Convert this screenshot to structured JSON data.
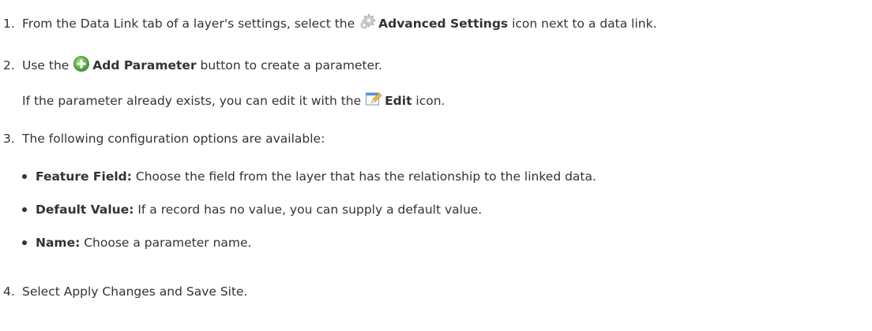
{
  "steps": [
    {
      "number": "1.",
      "pre": "From the Data Link tab of a layer's settings, select the",
      "icon": "gear-icon",
      "bold": "Advanced Settings",
      "post": "icon next to a data link."
    },
    {
      "number": "2.",
      "pre": "Use the",
      "icon": "add-plus-icon",
      "bold": "Add Parameter",
      "post": "button to create a parameter.",
      "note": {
        "pre": "If the parameter already exists, you can edit it with the",
        "icon": "edit-pencil-icon",
        "bold": "Edit",
        "post": "icon."
      }
    },
    {
      "number": "3.",
      "text": "The following configuration options are available:",
      "options": [
        {
          "label": "Feature Field:",
          "text": "Choose the field from the layer that has the relationship to the linked data."
        },
        {
          "label": "Default Value:",
          "text": "If a record has no value, you can supply a default value."
        },
        {
          "label": "Name:",
          "text": "Choose a parameter name."
        }
      ]
    },
    {
      "number": "4.",
      "text": "Select Apply Changes and Save Site."
    }
  ]
}
